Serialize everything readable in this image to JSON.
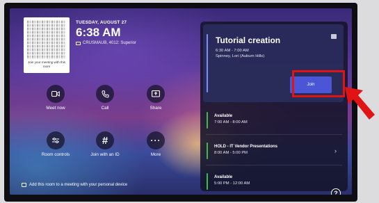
{
  "header": {
    "date": "TUESDAY, AUGUST 27",
    "time": "6:38 AM",
    "room": "CRUSMAUB, 4012: Superior"
  },
  "qr": {
    "caption": "Join your meeting with this room"
  },
  "actions": [
    {
      "label": "Meet now",
      "icon": "video-camera-icon"
    },
    {
      "label": "Call",
      "icon": "phone-icon"
    },
    {
      "label": "Share",
      "icon": "share-screen-icon"
    },
    {
      "label": "Room controls",
      "icon": "sliders-icon"
    },
    {
      "label": "Join with an ID",
      "icon": "hash-icon"
    },
    {
      "label": "More",
      "icon": "more-icon"
    }
  ],
  "agenda": {
    "current": {
      "title": "Tutorial creation",
      "time": "6:30 AM - 7:00 AM",
      "organizer": "Spinney, Lori (Auburn Hills)",
      "join_label": "Join"
    },
    "slots": [
      {
        "title": "Available",
        "time": "7:00 AM - 8:00 AM",
        "accent": "#3fb950"
      },
      {
        "title": "HOLD - IT Vendor Presentations",
        "time": "8:00 AM - 5:00 PM",
        "accent": "#3fb950"
      },
      {
        "title": "Available",
        "time": "5:00 PM - 12:00 AM",
        "accent": "#3fb950"
      }
    ]
  },
  "footer": {
    "text": "Add this room to a meeting with your personal device"
  },
  "help_label": "?",
  "colors": {
    "accent_blue": "#4a56d6",
    "highlight_red": "#e01414"
  }
}
